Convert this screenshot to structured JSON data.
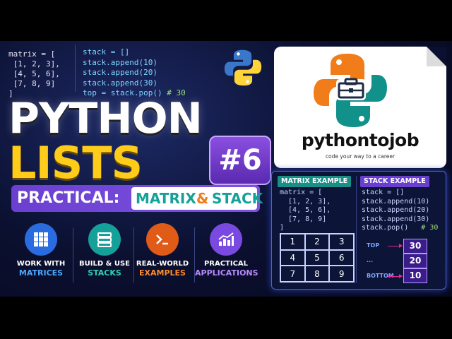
{
  "code_matrix": [
    "matrix = [",
    " [1, 2, 3],",
    " [4, 5, 6],",
    " [7, 8, 9]",
    "]"
  ],
  "code_stack": [
    {
      "text": "stack = []",
      "comment": ""
    },
    {
      "text": "stack.append(10)",
      "comment": ""
    },
    {
      "text": "stack.append(20)",
      "comment": ""
    },
    {
      "text": "stack.append(30)",
      "comment": ""
    },
    {
      "text": "top = stack.pop()",
      "comment": "# 30"
    }
  ],
  "title": {
    "line1": "PYTHON",
    "line2": "LISTS",
    "badge": "#6"
  },
  "subtitle": {
    "prefix": "PRACTICAL:",
    "word1": "MATRIX",
    "amp": "&",
    "word2": "STACK"
  },
  "features": [
    {
      "line1": "WORK WITH",
      "line2": "MATRICES",
      "accent": "#4aa8ff",
      "circle": "#2a6be0",
      "icon": "grid-icon"
    },
    {
      "line1": "BUILD & USE",
      "line2": "STACKS",
      "accent": "#2fd0b0",
      "circle": "#15a19a",
      "icon": "layers-icon"
    },
    {
      "line1": "REAL-WORLD",
      "line2": "EXAMPLES",
      "accent": "#ff8a2a",
      "circle": "#e05a18",
      "icon": "terminal-icon"
    },
    {
      "line1": "PRACTICAL",
      "line2": "APPLICATIONS",
      "accent": "#b88aff",
      "circle": "#7a4ae0",
      "icon": "chart-up-icon"
    }
  ],
  "brand": {
    "name": "pythontojob",
    "tagline": "code your way to a career",
    "colors": {
      "orange": "#f07c1a",
      "teal": "#12908a"
    }
  },
  "panel": {
    "matrix_label": "MATRIX EXAMPLE",
    "stack_label": "STACK EXAMPLE",
    "matrix_code": [
      "matrix = [",
      "  [1, 2, 3],",
      "  [4, 5, 6],",
      "  [7, 8, 9]",
      "]"
    ],
    "stack_code": [
      {
        "text": "stack = []",
        "comment": ""
      },
      {
        "text": "stack.append(10)",
        "comment": ""
      },
      {
        "text": "stack.append(20)",
        "comment": ""
      },
      {
        "text": "stack.append(30)",
        "comment": ""
      },
      {
        "text": "stack.pop()",
        "comment": "# 30"
      }
    ],
    "grid": [
      "1",
      "2",
      "3",
      "4",
      "5",
      "6",
      "7",
      "8",
      "9"
    ],
    "stack_items": [
      "30",
      "20",
      "10"
    ],
    "stack_labels": {
      "top": "TOP",
      "middle": "...",
      "bottom": "BOTTOM"
    }
  }
}
